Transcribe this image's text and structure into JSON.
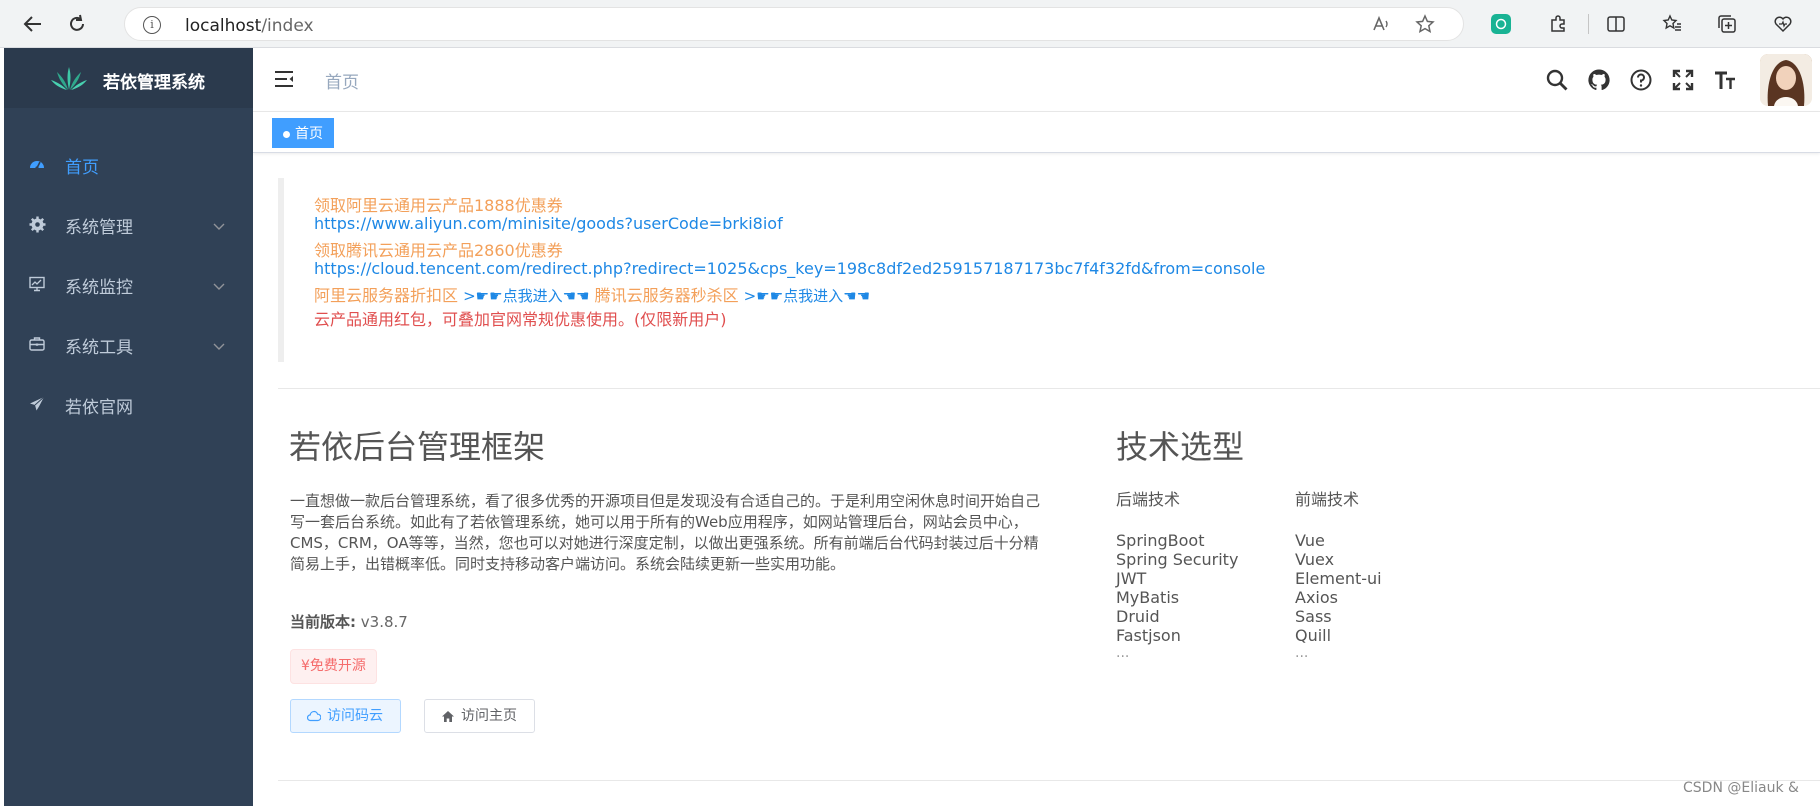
{
  "browser": {
    "url_host": "localhost",
    "url_path": "/index"
  },
  "sidebar": {
    "logo_text": "若依管理系统",
    "items": [
      {
        "label": "首页",
        "icon": "dashboard-icon",
        "active": true
      },
      {
        "label": "系统管理",
        "icon": "gear-icon",
        "has_children": true
      },
      {
        "label": "系统监控",
        "icon": "monitor-icon",
        "has_children": true
      },
      {
        "label": "系统工具",
        "icon": "toolbox-icon",
        "has_children": true
      },
      {
        "label": "若依官网",
        "icon": "paper-plane-icon"
      }
    ]
  },
  "navbar": {
    "breadcrumb": "首页"
  },
  "tags": {
    "active": "首页"
  },
  "notice": {
    "aliyun_title": "领取阿里云通用云产品1888优惠券",
    "aliyun_url": "https://www.aliyun.com/minisite/goods?userCode=brki8iof",
    "tencent_title": "领取腾讯云通用云产品2860优惠券",
    "tencent_url": "https://cloud.tencent.com/redirect.php?redirect=1025&cps_key=198c8df2ed259157187173bc7f4f32fd&from=console",
    "aliyun_zone": "阿里云服务器折扣区",
    "enter_link_1": ">☛☛点我进入☚☚",
    "tencent_zone": "腾讯云服务器秒杀区",
    "enter_link_2": ">☛☛点我进入☚☚",
    "red_note": "云产品通用红包，可叠加官网常规优惠使用。(仅限新用户)"
  },
  "intro": {
    "title": "若依后台管理框架",
    "description": "一直想做一款后台管理系统，看了很多优秀的开源项目但是发现没有合适自己的。于是利用空闲休息时间开始自己写一套后台系统。如此有了若依管理系统，她可以用于所有的Web应用程序，如网站管理后台，网站会员中心，CMS，CRM，OA等等，当然，您也可以对她进行深度定制，以做出更强系统。所有前端后台代码封装过后十分精简易上手，出错概率低。同时支持移动客户端访问。系统会陆续更新一些实用功能。",
    "version_label": "当前版本:",
    "version_value": "v3.8.7",
    "free_tag": "¥免费开源",
    "btn_gitee": "访问码云",
    "btn_home": "访问主页"
  },
  "tech": {
    "title": "技术选型",
    "backend_head": "后端技术",
    "backend": [
      "SpringBoot",
      "Spring Security",
      "JWT",
      "MyBatis",
      "Druid",
      "Fastjson"
    ],
    "frontend_head": "前端技术",
    "frontend": [
      "Vue",
      "Vuex",
      "Element-ui",
      "Axios",
      "Sass",
      "Quill"
    ],
    "more": "..."
  },
  "watermark": "CSDN @Eliauk &"
}
